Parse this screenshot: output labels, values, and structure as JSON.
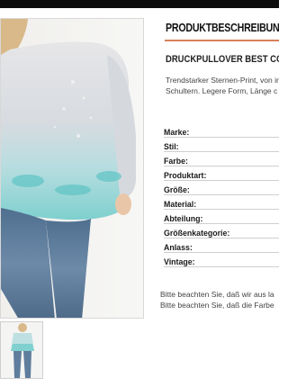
{
  "header": {
    "section_title": "PRODUKTBESCHREIBUNG",
    "accent_color": "#d9805b"
  },
  "product": {
    "name": "DRUCKPULLOVER BEST CON",
    "description_lines": [
      "Trendstarker Sternen-Print, von in",
      "Schultern. Legere Form, Länge c"
    ]
  },
  "attributes": [
    {
      "label": "Marke:"
    },
    {
      "label": "Stil:"
    },
    {
      "label": "Farbe:"
    },
    {
      "label": "Produktart:"
    },
    {
      "label": "Größe:"
    },
    {
      "label": "Material:"
    },
    {
      "label": "Abteilung:"
    },
    {
      "label": "Größenkategorie:"
    },
    {
      "label": "Anlass:"
    },
    {
      "label": "Vintage:"
    }
  ],
  "notes": [
    "Bitte beachten Sie, daß wir aus la",
    "Bitte beachten Sie, daß die Farbe"
  ],
  "images": {
    "main": "model-photo",
    "thumbnail": "model-thumbnail"
  }
}
